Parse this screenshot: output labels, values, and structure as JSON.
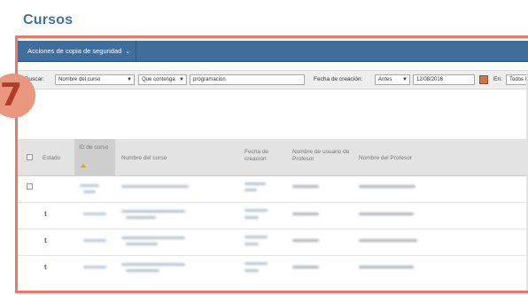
{
  "page": {
    "title": "Cursos"
  },
  "marker": {
    "label": "7"
  },
  "toolbar": {
    "backup_actions_label": "Acciones de copia de seguridad"
  },
  "search": {
    "label": "Buscar:",
    "field_value": "Nombre del curso",
    "operator_value": "Que contenga",
    "query_value": "programacion",
    "creation_date_label": "Fecha de creación:",
    "date_operator_value": "Antes",
    "date_value": "12/08/2016",
    "en_label": "En:",
    "en_value": "Todos l"
  },
  "table": {
    "headers": {
      "estado": "Estado",
      "id_curso": "ID de curso",
      "nombre_curso": "Nombre del curso",
      "fecha_creacion": "Fecha de creación",
      "nombre_usuario_profesor": "Nombre de usuario de Profesor",
      "nombre_profesor": "Nombre del Profesor"
    },
    "rows": [
      {
        "status_icon": "",
        "has_checkbox": true
      },
      {
        "status_icon": "t",
        "has_checkbox": false
      },
      {
        "status_icon": "t",
        "has_checkbox": false
      },
      {
        "status_icon": "t",
        "has_checkbox": false
      }
    ]
  },
  "colors": {
    "brand_blue": "#3f6d9c",
    "title_blue": "#44709a",
    "highlight_frame": "#e87a6a",
    "marker_fill": "#e9977f",
    "status_red": "#c0282d",
    "sort_arrow": "#e0a400"
  },
  "icons": {
    "sort": "sort-ascending-icon",
    "status": "status-unavailable-icon",
    "calendar": "calendar-icon"
  }
}
